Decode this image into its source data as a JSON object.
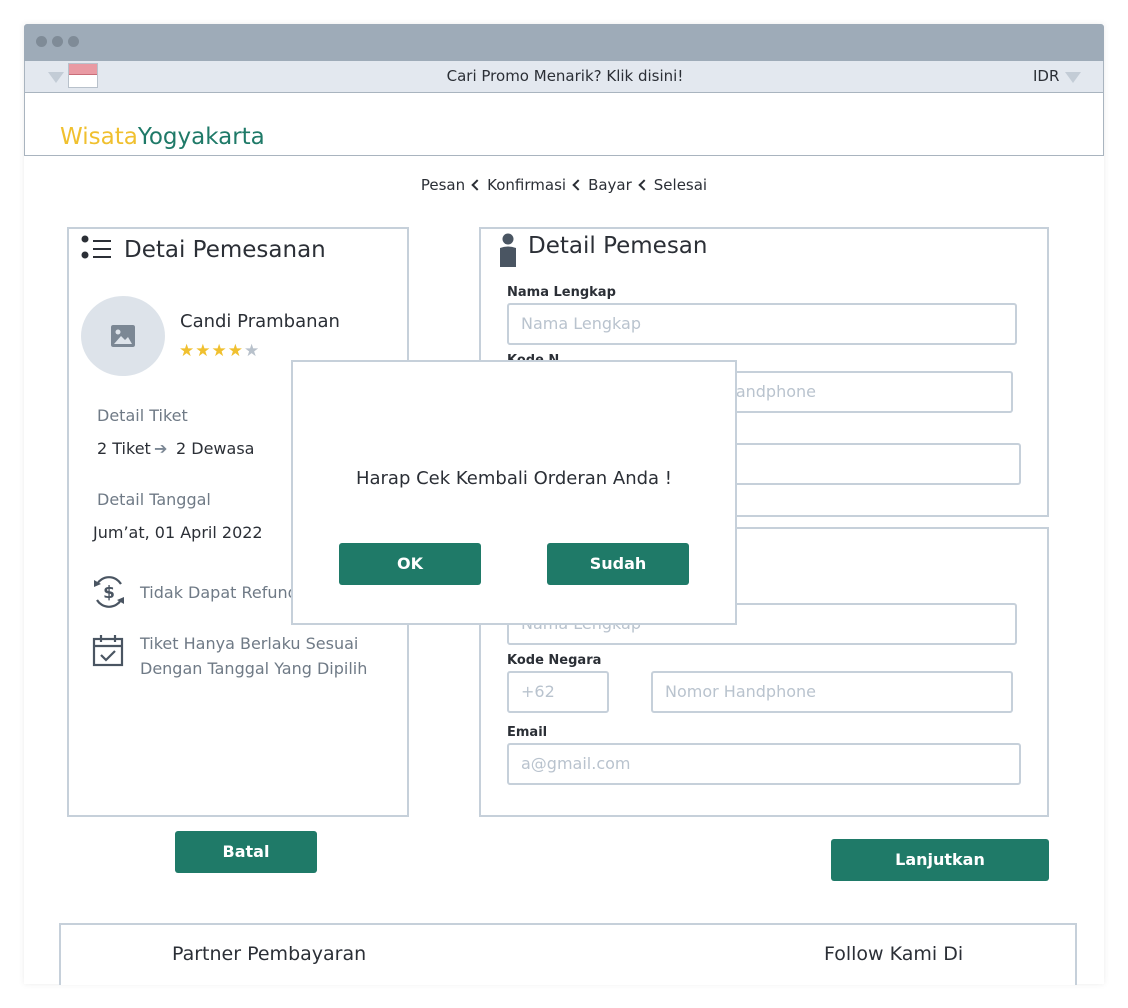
{
  "promo_bar": {
    "text": "Cari Promo Menarik? Klik disini!",
    "currency": "IDR"
  },
  "logo": {
    "part1": "Wisata",
    "part2": "Yogyakarta"
  },
  "steps": [
    "Pesan",
    "Konfirmasi",
    "Bayar",
    "Selesai"
  ],
  "order_detail": {
    "title": "Detai Pemesanan",
    "place_name": "Candi Prambanan",
    "rating": 4,
    "rating_max": 5,
    "ticket_label": "Detail Tiket",
    "ticket_count": "2 Tiket",
    "ticket_type": "2 Dewasa",
    "date_label": "Detail Tanggal",
    "date_value": "Jum’at, 01 April 2022",
    "refund_note": "Tidak Dapat Refund",
    "validity_note_line1": "Tiket Hanya Berlaku Sesuai",
    "validity_note_line2": "Dengan Tanggal Yang Dipilih"
  },
  "orderer_detail": {
    "title": "Detail Pemesan",
    "name_label": "Nama Lengkap",
    "name_placeholder": "Nama Lengkap",
    "phone_placeholder": "Nomor Handphone",
    "partial_label": "Kode N"
  },
  "visitor_detail": {
    "name_placeholder": "Nama Lengkap",
    "country_label": "Kode Negara",
    "country_placeholder": "+62",
    "phone_placeholder": "Nomor Handphone",
    "email_label": "Email",
    "email_placeholder": "a@gmail.com"
  },
  "buttons": {
    "cancel": "Batal",
    "continue": "Lanjutkan"
  },
  "modal": {
    "message": "Harap Cek Kembali Orderan Anda !",
    "ok": "OK",
    "done": "Sudah"
  },
  "footer": {
    "payment_partner": "Partner Pembayaran",
    "follow": "Follow Kami Di"
  }
}
